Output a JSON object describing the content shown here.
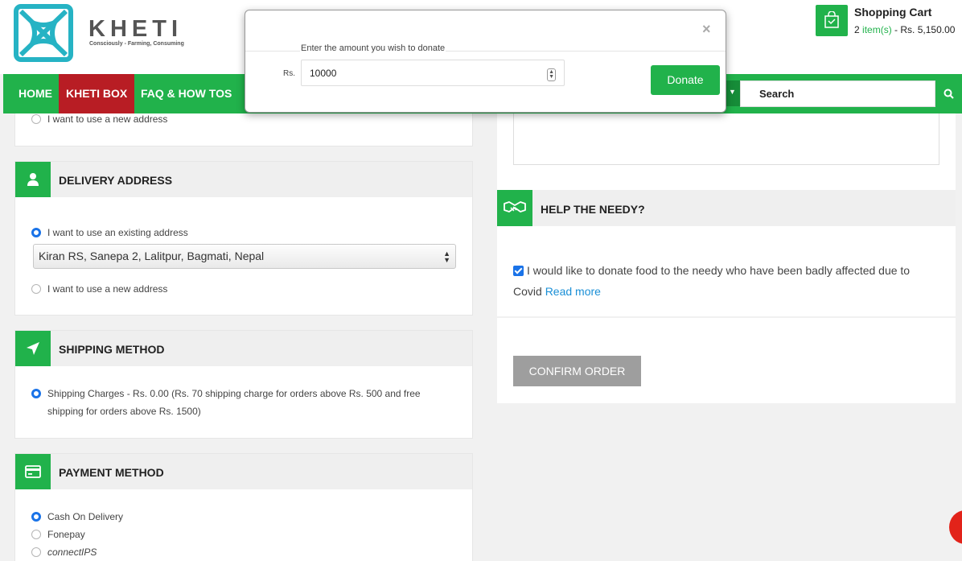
{
  "header": {
    "brand": "KHETI",
    "tagline": "Consciously - Farming, Consuming",
    "cart_title": "Shopping Cart",
    "cart_count": "2",
    "cart_items_label": "item(s)",
    "cart_total": "- Rs. 5,150.00"
  },
  "nav": {
    "items": [
      "HOME",
      "KHETI BOX",
      "FAQ & HOW TOS"
    ],
    "search_placeholder": "Search"
  },
  "billing": {
    "new_address_label": "I want to use a new address"
  },
  "delivery": {
    "title": "DELIVERY ADDRESS",
    "existing_label": "I want to use an existing address",
    "selected_address": "Kiran RS, Sanepa 2, Lalitpur, Bagmati, Nepal",
    "new_label": "I want to use a new address"
  },
  "shipping": {
    "title": "SHIPPING METHOD",
    "option_label": "Shipping Charges - Rs. 0.00 (Rs. 70 shipping charge for orders above Rs. 500 and free shipping for orders above Rs. 1500)"
  },
  "payment": {
    "title": "PAYMENT METHOD",
    "options": [
      "Cash On Delivery",
      "Fonepay",
      "connectIPS"
    ]
  },
  "needy": {
    "title": "HELP THE NEEDY?",
    "checkbox_text": "I would like to donate food to the needy who have been badly affected due to Covid",
    "read_more": "Read more",
    "checked": true
  },
  "confirm": {
    "label": "CONFIRM ORDER"
  },
  "modal": {
    "close": "×",
    "legend": "Enter the amount you wish to donate",
    "currency": "Rs.",
    "amount": "10000",
    "donate_label": "Donate"
  },
  "colors": {
    "brand_green": "#21b24b",
    "active_red": "#b81d24",
    "link_blue": "#1a8fd6"
  }
}
